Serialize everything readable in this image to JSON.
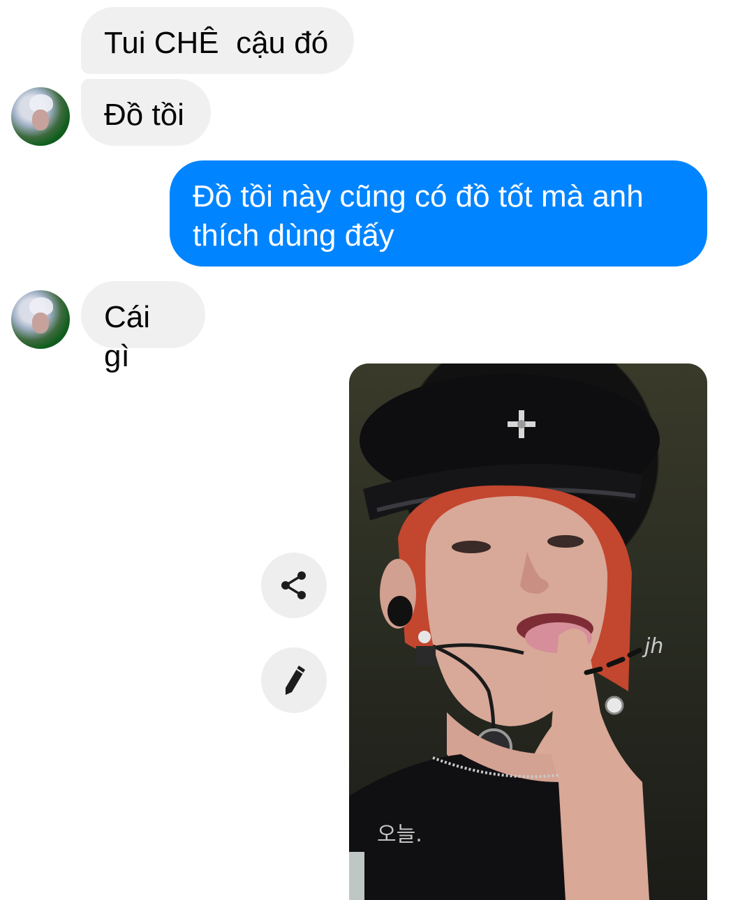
{
  "messages": [
    {
      "id": "m1",
      "direction": "incoming",
      "text": "Tui CHÊ  cậu đó"
    },
    {
      "id": "m2",
      "direction": "incoming",
      "text": "Đồ tồi"
    },
    {
      "id": "m3",
      "direction": "outgoing",
      "text": "Đồ tồi này cũng có đồ tốt mà anh thích dùng đấy"
    },
    {
      "id": "m4",
      "direction": "incoming",
      "text": "Cái gì"
    }
  ],
  "photo": {
    "watermarks": [
      "jh",
      "오늘."
    ]
  },
  "actions": {
    "share_icon": "share-icon",
    "edit_icon": "pencil-icon"
  },
  "colors": {
    "outgoing_bubble": "#0084ff",
    "incoming_bubble": "#f0f0f0",
    "action_button": "#eeeeee"
  }
}
